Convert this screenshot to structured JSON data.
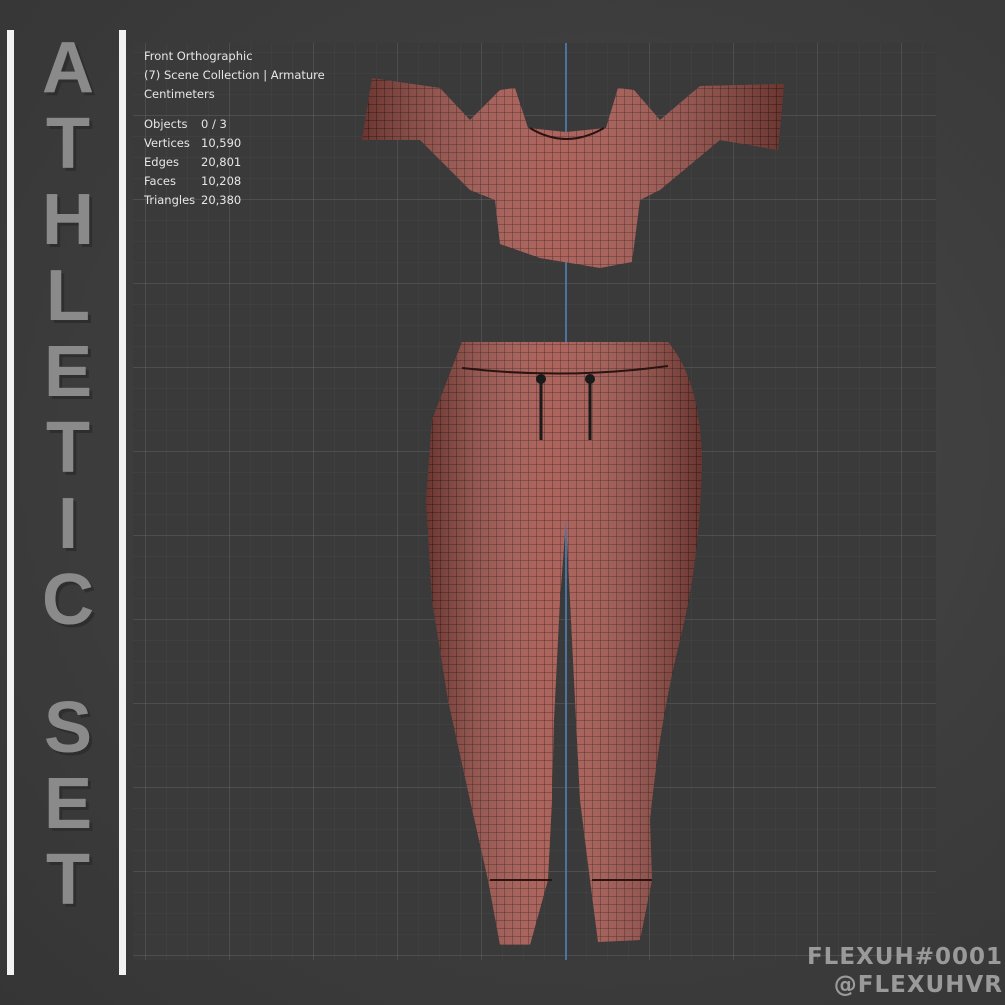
{
  "title": {
    "letters": [
      "A",
      "T",
      "H",
      "L",
      "E",
      "T",
      "I",
      "C"
    ],
    "letters2": [
      "S",
      "E",
      "T"
    ]
  },
  "viewport": {
    "view_name": "Front Orthographic",
    "collection": "(7) Scene Collection | Armature",
    "units": "Centimeters",
    "stats": [
      {
        "label": "Objects",
        "value": "0 / 3"
      },
      {
        "label": "Vertices",
        "value": "10,590"
      },
      {
        "label": "Edges",
        "value": "20,801"
      },
      {
        "label": "Faces",
        "value": "10,208"
      },
      {
        "label": "Triangles",
        "value": "20,380"
      }
    ]
  },
  "watermark": {
    "line1": "FLEXUH#0001",
    "line2": "@FLEXUHVR"
  },
  "colors": {
    "mesh": "#a3524a",
    "wire": "#2a1310",
    "background": "#3d3d3d",
    "axis": "#4d79a8"
  }
}
